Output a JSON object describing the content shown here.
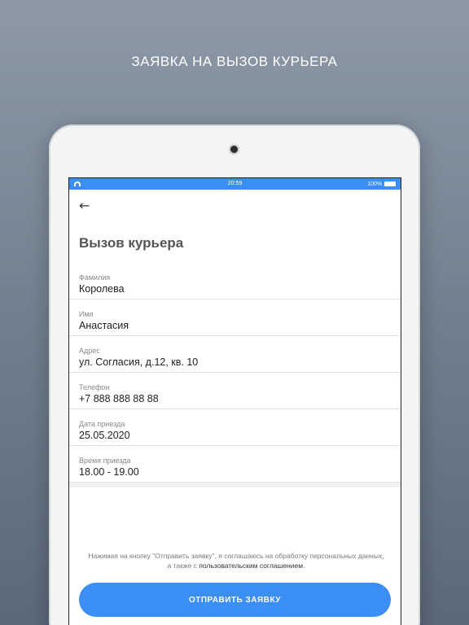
{
  "page_heading": "ЗАЯВКА НА ВЫЗОВ КУРЬЕРА",
  "status_bar": {
    "time": "20:59",
    "battery": "100%"
  },
  "screen": {
    "title": "Вызов курьера",
    "fields": [
      {
        "label": "Фамилия",
        "value": "Королева"
      },
      {
        "label": "Имя",
        "value": "Анастасия"
      },
      {
        "label": "Адрес",
        "value": "ул. Согласия, д.12, кв. 10"
      },
      {
        "label": "Телефон",
        "value": "+7 888 888 88 88"
      },
      {
        "label": "Дата приезда",
        "value": "25.05.2020"
      },
      {
        "label": "Время приезда",
        "value": "18.00 - 19.00"
      }
    ],
    "consent_text": "Нажимая на кнопку \"Отправить заявку\", я соглашаюсь на обработку персональных данных, а также с",
    "consent_link": "пользовательским соглашением",
    "consent_end": ".",
    "submit_label": "ОТПРАВИТЬ ЗАЯВКУ"
  },
  "colors": {
    "accent": "#3b8ef3"
  },
  "icons": {
    "back": "arrow-left-icon",
    "wifi": "wifi-icon",
    "battery": "battery-icon"
  }
}
